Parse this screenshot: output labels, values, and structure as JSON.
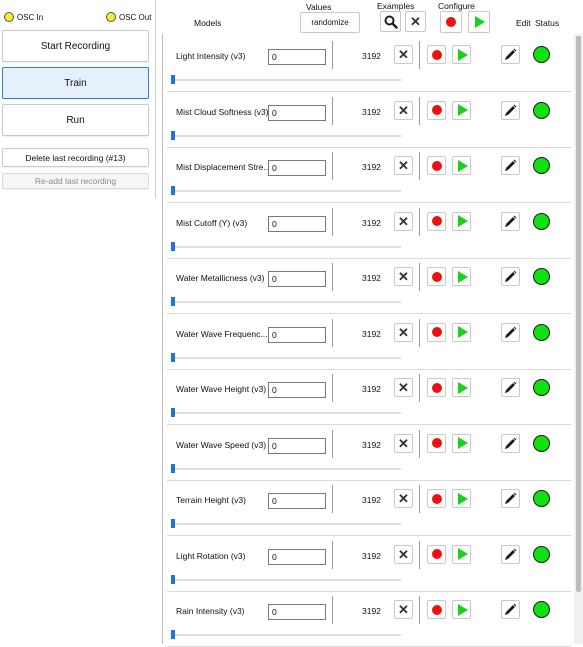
{
  "left": {
    "osc_in": "OSC In",
    "osc_out": "OSC Out",
    "start_recording": "Start Recording",
    "train": "Train",
    "run": "Run",
    "delete_last": "Delete last recording (#13)",
    "readd_last": "Re-add last recording"
  },
  "header": {
    "models": "Models",
    "values": "Values",
    "randomize": "randomize",
    "examples": "Examples",
    "configure": "Configure",
    "edit": "Edit",
    "status": "Status"
  },
  "colors": {
    "osc_indicator": "#f5ec32",
    "record": "#ee1111",
    "run": "#1bd11b",
    "status_ok": "#10e210",
    "slider_fill": "#1f75d8"
  },
  "models": [
    {
      "name": "Light Intensity (v3)",
      "value": "0",
      "examples": "3192",
      "status": "ok",
      "slider_level": 0.0
    },
    {
      "name": "Mist Cloud Softness (v3)",
      "value": "0",
      "examples": "3192",
      "status": "ok",
      "slider_level": 0.0
    },
    {
      "name": "Mist Displacement Stre...",
      "value": "0",
      "examples": "3192",
      "status": "ok",
      "slider_level": 0.0
    },
    {
      "name": "Mist Cutoff (Y) (v3)",
      "value": "0",
      "examples": "3192",
      "status": "ok",
      "slider_level": 0.0
    },
    {
      "name": "Water Metallicness (v3)",
      "value": "0",
      "examples": "3192",
      "status": "ok",
      "slider_level": 0.0
    },
    {
      "name": "Water Wave Frequenc...",
      "value": "0",
      "examples": "3192",
      "status": "ok",
      "slider_level": 0.0
    },
    {
      "name": "Water Wave Height (v3)",
      "value": "0",
      "examples": "3192",
      "status": "ok",
      "slider_level": 0.0
    },
    {
      "name": "Water Wave Speed (v3)",
      "value": "0",
      "examples": "3192",
      "status": "ok",
      "slider_level": 0.0
    },
    {
      "name": "Terrain Height (v3)",
      "value": "0",
      "examples": "3192",
      "status": "ok",
      "slider_level": 0.0
    },
    {
      "name": "Light Rotation (v3)",
      "value": "0",
      "examples": "3192",
      "status": "ok",
      "slider_level": 0.0
    },
    {
      "name": "Rain Intensity (v3)",
      "value": "0",
      "examples": "3192",
      "status": "ok",
      "slider_level": 0.0
    }
  ]
}
